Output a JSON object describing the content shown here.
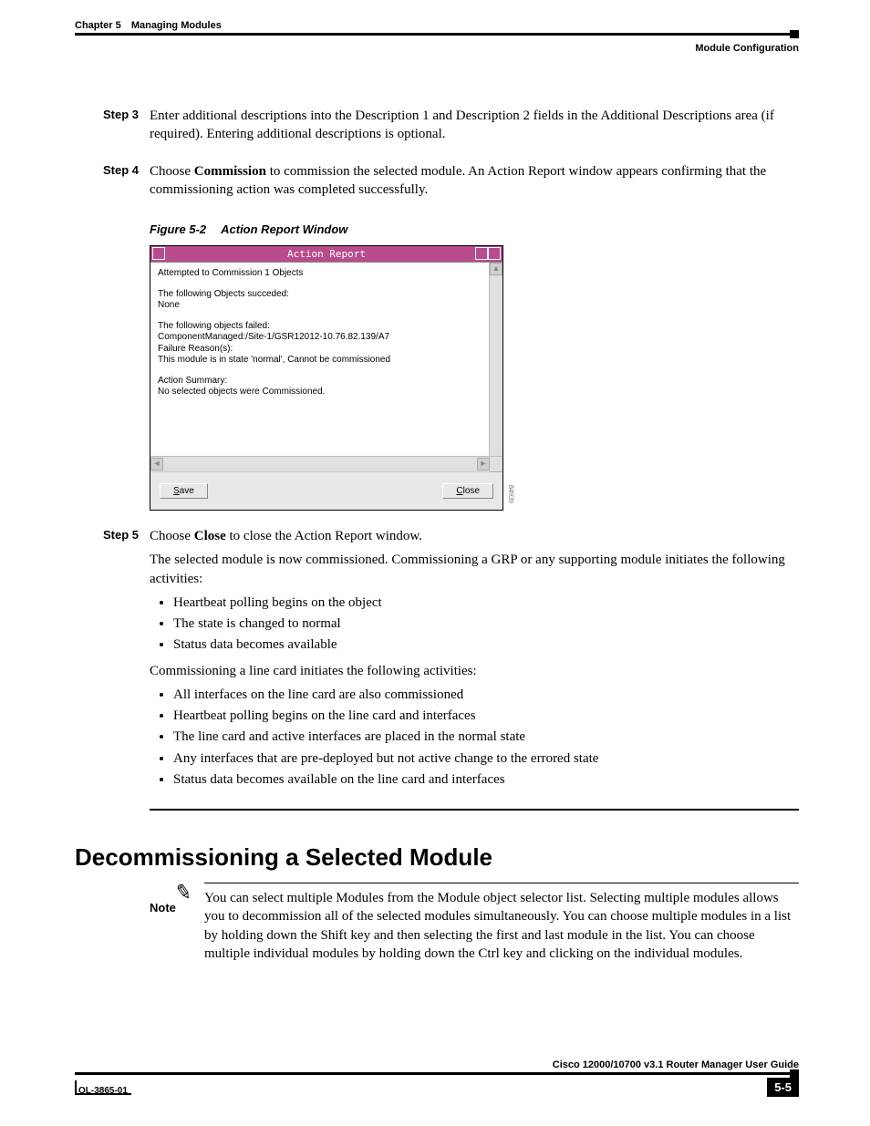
{
  "header": {
    "chapter_num": "Chapter 5",
    "chapter_title": "Managing Modules",
    "section": "Module Configuration"
  },
  "steps": {
    "s3": {
      "label": "Step 3",
      "text": "Enter additional descriptions into the Description 1 and Description 2 fields in the Additional Descriptions area (if required). Entering additional descriptions is optional."
    },
    "s4": {
      "label": "Step 4",
      "before": "Choose ",
      "bold": "Commission",
      "after": " to commission the selected module. An Action Report window appears confirming that the commissioning action was completed successfully."
    },
    "s5": {
      "label": "Step 5",
      "before": "Choose ",
      "bold": "Close",
      "after": " to close the Action Report window.",
      "para2": "The selected module is now commissioned. Commissioning a GRP or any supporting module initiates the following activities:",
      "list1": [
        "Heartbeat polling begins on the object",
        "The state is changed to normal",
        "Status data becomes available"
      ],
      "para3": "Commissioning a line card initiates the following activities:",
      "list2": [
        "All interfaces on the line card are also commissioned",
        "Heartbeat polling begins on the line card and interfaces",
        "The line card and active interfaces are placed in the normal state",
        "Any interfaces that are pre-deployed but not active change to the errored state",
        "Status data becomes available on the line card and interfaces"
      ]
    }
  },
  "figure": {
    "number": "Figure 5-2",
    "title": "Action Report Window",
    "ref": "84939",
    "window_title": "Action Report",
    "lines": {
      "l1": "Attempted to Commission 1 Objects",
      "l2": "The following Objects succeded:",
      "l3": "None",
      "l4": "The following objects failed:",
      "l5": "ComponentManaged:/Site-1/GSR12012-10.76.82.139/A7",
      "l6": "Failure Reason(s):",
      "l7": "This module is in  state 'normal', Cannot be commissioned",
      "l8": "Action Summary:",
      "l9": "No selected objects were Commissioned."
    },
    "save_u": "S",
    "save_rest": "ave",
    "close_u": "C",
    "close_rest": "lose"
  },
  "heading2": "Decommissioning a Selected Module",
  "note": {
    "label": "Note",
    "text": "You can select multiple Modules from the Module object selector list. Selecting multiple modules allows you to decommission all of the selected modules simultaneously. You can choose multiple modules in a list by holding down the Shift key and then selecting the first and last module in the list. You can choose multiple individual modules by holding down the Ctrl key and clicking on the individual modules."
  },
  "footer": {
    "guide": "Cisco 12000/10700 v3.1 Router Manager User Guide",
    "docnum": "OL-3865-01",
    "pagenum": "5-5"
  }
}
